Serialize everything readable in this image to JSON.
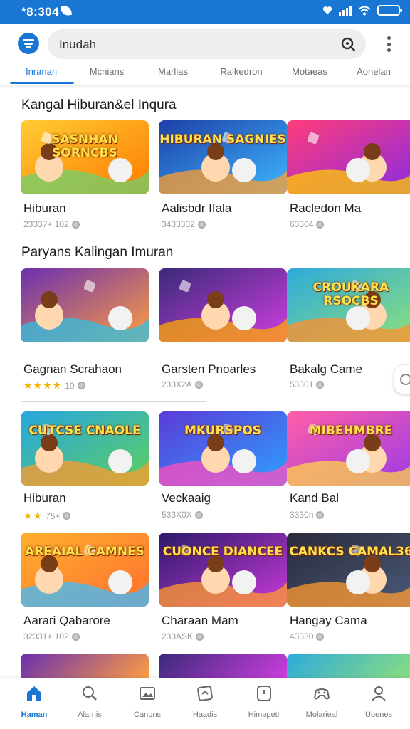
{
  "status": {
    "time": "*8:304"
  },
  "search": {
    "query": "Inudah"
  },
  "tabs": [
    "Inranan",
    "Mcnians",
    "Marlias",
    "Ralkedron",
    "Motaeas",
    "Aonelan"
  ],
  "sections": [
    {
      "title": "Kangal Hiburan&el Inqura"
    },
    {
      "title": "Paryans Kalingan Imuran"
    }
  ],
  "cards": [
    {
      "title": "Hiburan",
      "meta": "23337+ 102",
      "stars": "",
      "thumb_text": "SASNHAN SORNCBS"
    },
    {
      "title": "Aalisbdr Ifala",
      "meta": "3433302",
      "stars": "",
      "thumb_text": "HIBURAN SAGNIES"
    },
    {
      "title": "Racledon Ma",
      "meta": "63304",
      "stars": "",
      "thumb_text": ""
    },
    {
      "title": "Gagnan Scrahaon",
      "meta": "10",
      "stars": "★★★★",
      "thumb_text": ""
    },
    {
      "title": "Garsten Pnoarles",
      "meta": "233X2A",
      "stars": "",
      "thumb_text": ""
    },
    {
      "title": "Bakalg Came",
      "meta": "53301",
      "stars": "",
      "thumb_text": "CROUKARA RSOCBS"
    },
    {
      "title": "Hiburan",
      "meta": "75+",
      "stars": "★★",
      "thumb_text": "CUTCSE CNAOLE"
    },
    {
      "title": "Veckaaig",
      "meta": "533X0X",
      "stars": "",
      "thumb_text": "MKURSPOS"
    },
    {
      "title": "Kand Bal",
      "meta": "3330n",
      "stars": "",
      "thumb_text": "MIBEHMBRE"
    },
    {
      "title": "Aarari Qabarore",
      "meta": "32331+ 102",
      "stars": "",
      "thumb_text": "AREAIAL CAMNES"
    },
    {
      "title": "Charaan Mam",
      "meta": "233ASK",
      "stars": "",
      "thumb_text": "CUONCE DIANCEE"
    },
    {
      "title": "Hangay Cama",
      "meta": "43330",
      "stars": "",
      "thumb_text": "CANKCS CAMAL36"
    }
  ],
  "nav": [
    "Haman",
    "Alarnis",
    "Canpns",
    "Haadis",
    "Himapetr",
    "Molarieal",
    "Uoenes"
  ],
  "colors": {
    "accent": "#1976d2",
    "star": "#f0b400"
  },
  "icons": {
    "logo": "app-logo-icon",
    "search": "search-icon",
    "more": "more-vert-icon",
    "nav": [
      "home-icon",
      "search-icon",
      "image-icon",
      "ticket-icon",
      "badge-icon",
      "gamepad-icon",
      "profile-icon"
    ]
  }
}
